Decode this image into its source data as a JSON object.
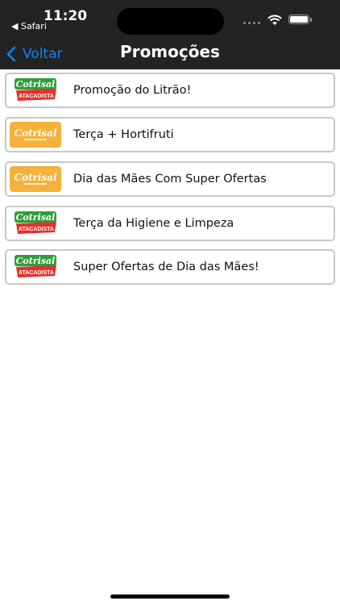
{
  "status_bar": {
    "time": "11:20",
    "back_app": "◀ Safari"
  },
  "nav": {
    "back_label": "Voltar",
    "title": "Promoções"
  },
  "colors": {
    "header_bg": "#232323",
    "accent": "#0a84ff",
    "logo_green": "#2e9e3a",
    "logo_red": "#e0342c",
    "logo_yellow": "#f4b23a"
  },
  "promotions": [
    {
      "label": "Promoção do Litrão!",
      "logo": "cotrisal-atacadista-logo",
      "logo_brand": "Cotrisal",
      "logo_tag": "ATACADISTA"
    },
    {
      "label": "Terça + Hortifruti",
      "logo": "cotrisal-supermercado-logo",
      "logo_brand": "Cotrisal",
      "logo_tag": ""
    },
    {
      "label": "Dia das Mães Com Super Ofertas",
      "logo": "cotrisal-supermercado-logo",
      "logo_brand": "Cotrisal",
      "logo_tag": ""
    },
    {
      "label": "Terça da Higiene e Limpeza",
      "logo": "cotrisal-atacadista-logo",
      "logo_brand": "Cotrisal",
      "logo_tag": "ATACADISTA"
    },
    {
      "label": "Super Ofertas de Dia das Mães!",
      "logo": "cotrisal-atacadista-logo",
      "logo_brand": "Cotrisal",
      "logo_tag": "ATACADISTA"
    }
  ]
}
